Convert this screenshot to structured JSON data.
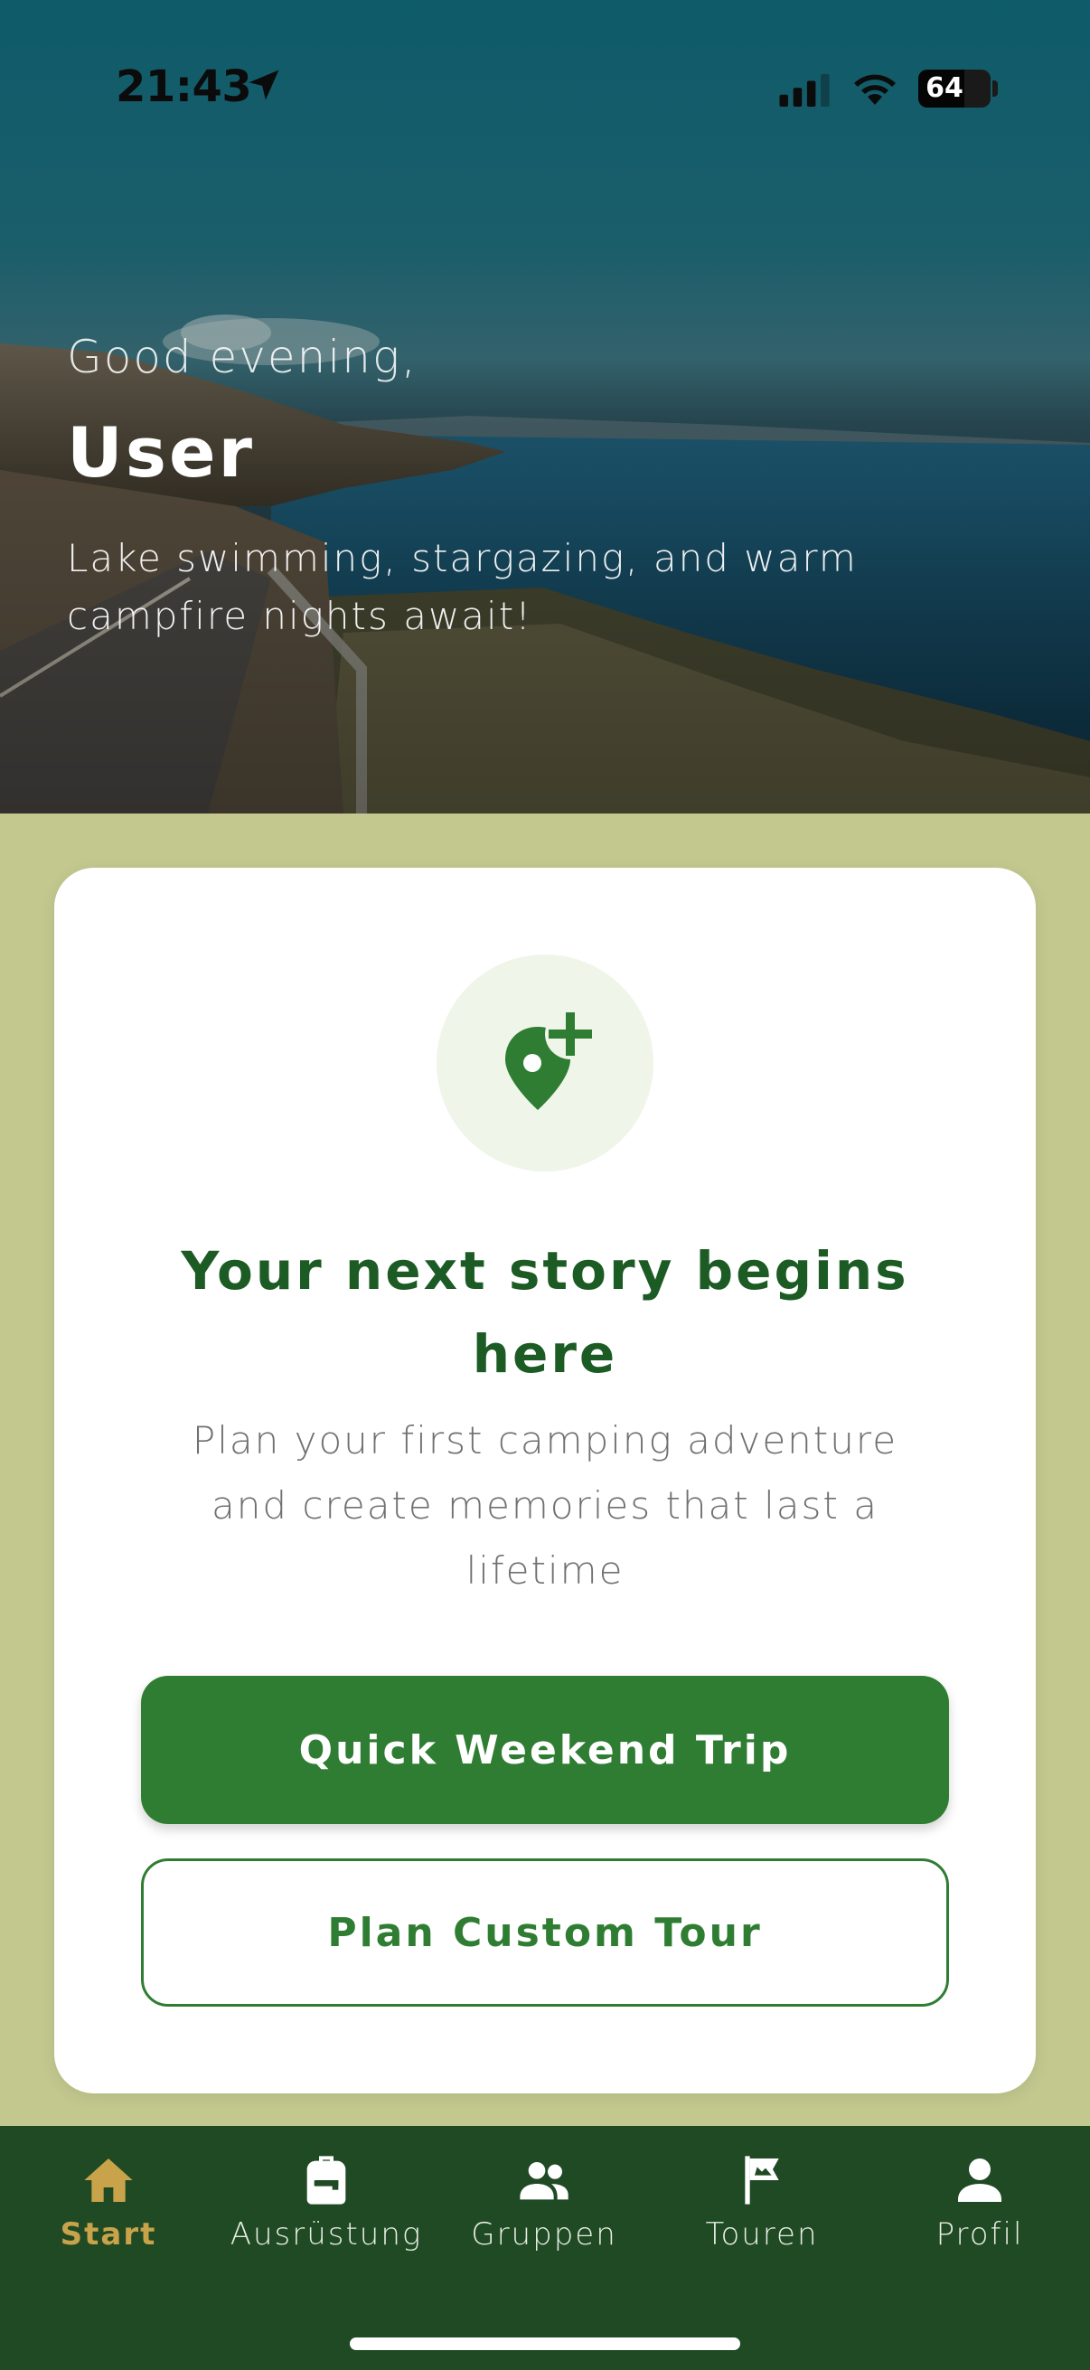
{
  "status_bar": {
    "time": "21:43",
    "battery_level": "64",
    "battery_fraction": 0.64
  },
  "hero": {
    "greeting": "Good evening,",
    "user_name": "User",
    "subtitle": "Lake swimming, stargazing, and warm campfire nights await!"
  },
  "card": {
    "icon": "add-location-icon",
    "title": "Your next story begins here",
    "subtitle": "Plan your first camping adventure and create memories that last a lifetime",
    "primary_button": "Quick Weekend Trip",
    "secondary_button": "Plan Custom Tour"
  },
  "nav": {
    "items": [
      {
        "label": "Start",
        "icon": "home-icon",
        "active": true
      },
      {
        "label": "Ausrüstung",
        "icon": "backpack-icon",
        "active": false
      },
      {
        "label": "Gruppen",
        "icon": "group-icon",
        "active": false
      },
      {
        "label": "Touren",
        "icon": "flag-icon",
        "active": false
      },
      {
        "label": "Profil",
        "icon": "person-icon",
        "active": false
      }
    ]
  },
  "colors": {
    "primary": "#2f7d32",
    "title_green": "#1d5b25",
    "page_background": "#c2c88e",
    "nav_background": "#1f4a24",
    "nav_active": "#c9a34a"
  }
}
